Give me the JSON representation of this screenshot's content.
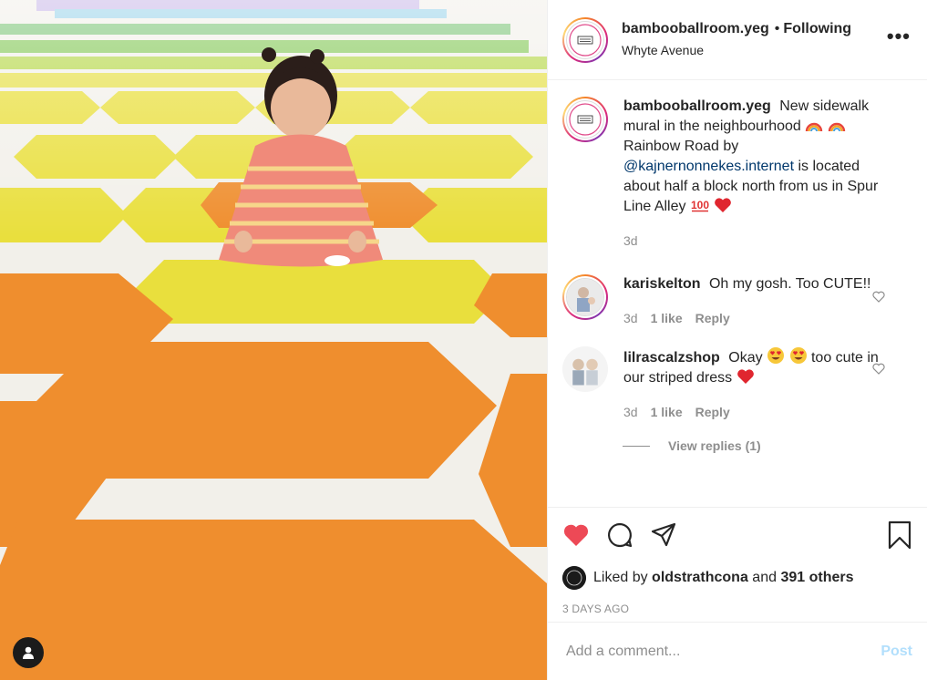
{
  "header": {
    "username": "bambooballroom.yeg",
    "separator": "•",
    "follow_status": "Following",
    "location": "Whyte Avenue",
    "more_icon": "more-options-icon",
    "more_label": "•••"
  },
  "caption": {
    "username": "bambooballroom.yeg",
    "text_1": "New sidewalk mural in the neighbourhood",
    "emojis_1": [
      "rainbow",
      "rainbow"
    ],
    "text_2": "Rainbow Road by",
    "mention": "@kajnernonnekes.internet",
    "text_3": "is located about half a block north from us in Spur Line Alley",
    "emojis_2": [
      "hundred-points",
      "red-heart"
    ],
    "time": "3d"
  },
  "comments": [
    {
      "username": "kariskelton",
      "text": "Oh my gosh. Too CUTE!!",
      "time": "3d",
      "likes": "1 like",
      "reply": "Reply"
    },
    {
      "username": "lilrascalzshop",
      "text_before": "Okay",
      "emojis": [
        "heart-eyes",
        "heart-eyes"
      ],
      "text_after": "too cute in our striped dress",
      "end_emoji": "red-heart",
      "time": "3d",
      "likes": "1 like",
      "reply": "Reply",
      "view_replies": "View replies (1)"
    }
  ],
  "actions": {
    "icons": [
      "heart-filled-icon",
      "comment-icon",
      "share-icon",
      "bookmark-icon"
    ],
    "like_color": "#ed4956"
  },
  "likes": {
    "prefix": "Liked by",
    "user": "oldstrathcona",
    "joiner": "and",
    "others": "391 others"
  },
  "date": "3 DAYS AGO",
  "comment_box": {
    "placeholder": "Add a comment...",
    "post_label": "Post"
  },
  "colors": {
    "accent_link": "#00376b",
    "post_button": "#b2dffc",
    "muted": "#8e8e8e"
  }
}
